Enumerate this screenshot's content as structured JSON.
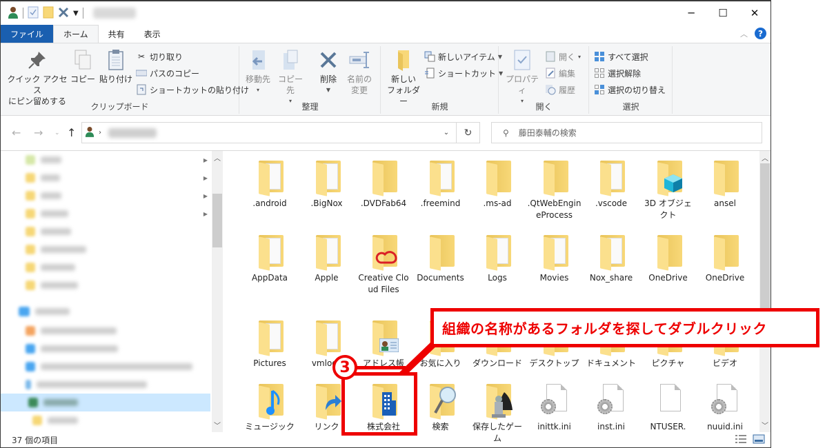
{
  "titlebar": {
    "window_title": "(blurred)",
    "minimize_label": "─",
    "maximize_label": "☐",
    "close_label": "✕"
  },
  "tabs": [
    {
      "label": "ファイル"
    },
    {
      "label": "ホーム"
    },
    {
      "label": "共有"
    },
    {
      "label": "表示"
    }
  ],
  "ribbon": {
    "clipboard": {
      "label": "クリップボード",
      "pin": "クイック アクセス\nにピン留めする",
      "copy": "コピー",
      "paste": "貼り付け",
      "cut": "切り取り",
      "copy_path": "パスのコピー",
      "paste_shortcut": "ショートカットの貼り付け"
    },
    "organize": {
      "label": "整理",
      "move_to": "移動先",
      "copy_to": "コピー先",
      "delete": "削除",
      "rename": "名前の\n変更"
    },
    "new": {
      "label": "新規",
      "new_folder": "新しい\nフォルダー",
      "new_item": "新しいアイテム",
      "shortcut": "ショートカット"
    },
    "open": {
      "label": "開く",
      "properties": "プロパティ",
      "open": "開く",
      "edit": "編集",
      "history": "履歴"
    },
    "select": {
      "label": "選択",
      "select_all": "すべて選択",
      "select_none": "選択解除",
      "invert": "選択の切り替え"
    }
  },
  "address": {
    "search_placeholder": "藤田泰輔の検索"
  },
  "nav_pane": {
    "items": [
      "(blurred)",
      "(blurred)",
      "(blurred)",
      "(blurred)",
      "(blurred)",
      "(blurred)",
      "(blurred)",
      "(blurred)",
      "(blurred)",
      "(blurred)",
      "(blurred)",
      "(blurred)",
      "(blurred)",
      "(blurred)",
      "(blurred)"
    ]
  },
  "files": [
    {
      "name": ".android",
      "type": "folder-doc"
    },
    {
      "name": ".BigNox",
      "type": "folder-doc"
    },
    {
      "name": ".DVDFab64",
      "type": "folder"
    },
    {
      "name": ".freemind",
      "type": "folder-doc"
    },
    {
      "name": ".ms-ad",
      "type": "folder"
    },
    {
      "name": ".QtWebEngineProcess",
      "type": "folder"
    },
    {
      "name": ".vscode",
      "type": "folder-doc"
    },
    {
      "name": "3D オブジェクト",
      "type": "folder-3d"
    },
    {
      "name": "ansel",
      "type": "folder"
    },
    {
      "name": "AppData",
      "type": "folder-doc"
    },
    {
      "name": "Apple",
      "type": "folder-doc"
    },
    {
      "name": "Creative Cloud Files",
      "type": "folder-cc"
    },
    {
      "name": "Documents",
      "type": "folder"
    },
    {
      "name": "Logs",
      "type": "folder-doc"
    },
    {
      "name": "Movies",
      "type": "folder-doc"
    },
    {
      "name": "Nox_share",
      "type": "folder-doc"
    },
    {
      "name": "OneDrive",
      "type": "folder"
    },
    {
      "name": "OneDrive",
      "type": "folder"
    },
    {
      "name": "Pictures",
      "type": "folder-doc"
    },
    {
      "name": "vmlogs",
      "type": "folder-doc"
    },
    {
      "name": "アドレス帳",
      "type": "folder-contacts"
    },
    {
      "name": "お気に入り",
      "type": "folder"
    },
    {
      "name": "ダウンロード",
      "type": "folder"
    },
    {
      "name": "デスクトップ",
      "type": "folder"
    },
    {
      "name": "ドキュメント",
      "type": "folder"
    },
    {
      "name": "ピクチャ",
      "type": "folder"
    },
    {
      "name": "ビデオ",
      "type": "folder"
    },
    {
      "name": "ミュージック",
      "type": "folder-music"
    },
    {
      "name": "リンク",
      "type": "folder-link"
    },
    {
      "name": "株式会社",
      "type": "folder-company"
    },
    {
      "name": "検索",
      "type": "folder-search"
    },
    {
      "name": "保存したゲーム",
      "type": "folder-games"
    },
    {
      "name": "inittk.ini",
      "type": "ini"
    },
    {
      "name": "inst.ini",
      "type": "ini"
    },
    {
      "name": "NTUSER.",
      "type": "file"
    },
    {
      "name": "nuuid.ini",
      "type": "ini"
    }
  ],
  "status": {
    "item_count": "37 個の項目"
  },
  "annotation": {
    "step": "3",
    "text": "組織の名称があるフォルダを探してダブルクリック",
    "color": "#ee0000"
  }
}
